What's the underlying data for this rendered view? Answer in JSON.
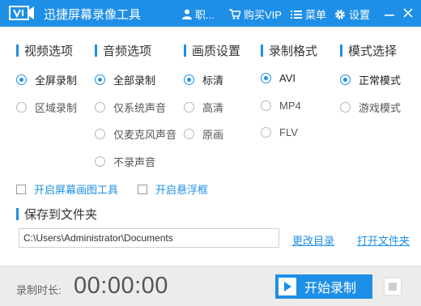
{
  "titlebar": {
    "title": "迅捷屏幕录像工具",
    "user_label": "职...",
    "vip_label": "购买VIP",
    "menu_label": "菜单",
    "settings_label": "设置"
  },
  "sections": {
    "video": {
      "title": "视频选项",
      "options": [
        {
          "label": "全屏录制",
          "selected": true
        },
        {
          "label": "区域录制",
          "selected": false
        }
      ]
    },
    "audio": {
      "title": "音频选项",
      "options": [
        {
          "label": "全部录制",
          "selected": true
        },
        {
          "label": "仅系统声音",
          "selected": false
        },
        {
          "label": "仅麦克风声音",
          "selected": false
        },
        {
          "label": "不录声音",
          "selected": false
        }
      ]
    },
    "quality": {
      "title": "画质设置",
      "options": [
        {
          "label": "标清",
          "selected": true
        },
        {
          "label": "高清",
          "selected": false
        },
        {
          "label": "原画",
          "selected": false
        }
      ]
    },
    "format": {
      "title": "录制格式",
      "options": [
        {
          "label": "AVI",
          "selected": true
        },
        {
          "label": "MP4",
          "selected": false
        },
        {
          "label": "FLV",
          "selected": false
        }
      ]
    },
    "mode": {
      "title": "模式选择",
      "options": [
        {
          "label": "正常模式",
          "selected": true
        },
        {
          "label": "游戏模式",
          "selected": false
        }
      ]
    }
  },
  "checkboxes": {
    "draw_tool": {
      "label": "开启屏幕画图工具",
      "checked": false
    },
    "float_box": {
      "label": "开启悬浮框",
      "checked": false
    }
  },
  "save": {
    "title": "保存到文件夹",
    "path": "C:\\Users\\Administrator\\Documents",
    "change_label": "更改目录",
    "open_label": "打开文件夹"
  },
  "footer": {
    "duration_label": "录制时长:",
    "timer": "00:00:00",
    "start_label": "开始录制"
  },
  "colors": {
    "accent": "#1e8fe6",
    "footer_bg": "#ececec"
  }
}
